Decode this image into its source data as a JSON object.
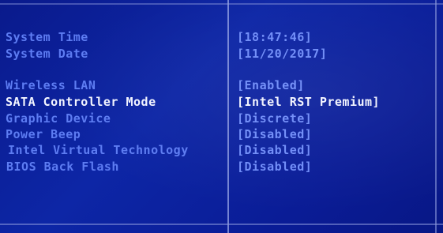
{
  "settings": {
    "system_time": {
      "label": "System Time",
      "value": "[18:47:46]"
    },
    "system_date": {
      "label": "System Date",
      "value": "[11/20/2017]"
    },
    "wireless_lan": {
      "label": "Wireless LAN",
      "value": "[Enabled]"
    },
    "sata_mode": {
      "label": "SATA Controller Mode",
      "value": "[Intel RST Premium]"
    },
    "graphic_device": {
      "label": "Graphic Device",
      "value": "[Discrete]"
    },
    "power_beep": {
      "label": "Power Beep",
      "value": "[Disabled]"
    },
    "intel_vt": {
      "label": "Intel Virtual Technology",
      "value": "[Disabled]"
    },
    "bios_flash": {
      "label": "BIOS Back Flash",
      "value": "[Disabled]"
    }
  },
  "selected_item": "sata_mode",
  "colors": {
    "background": "#0a1e94",
    "label_text": "#5d7cf2",
    "value_text": "#6f8cf8",
    "selected_text": "#f2f4ff",
    "frame_lines": "#8c99dc"
  }
}
